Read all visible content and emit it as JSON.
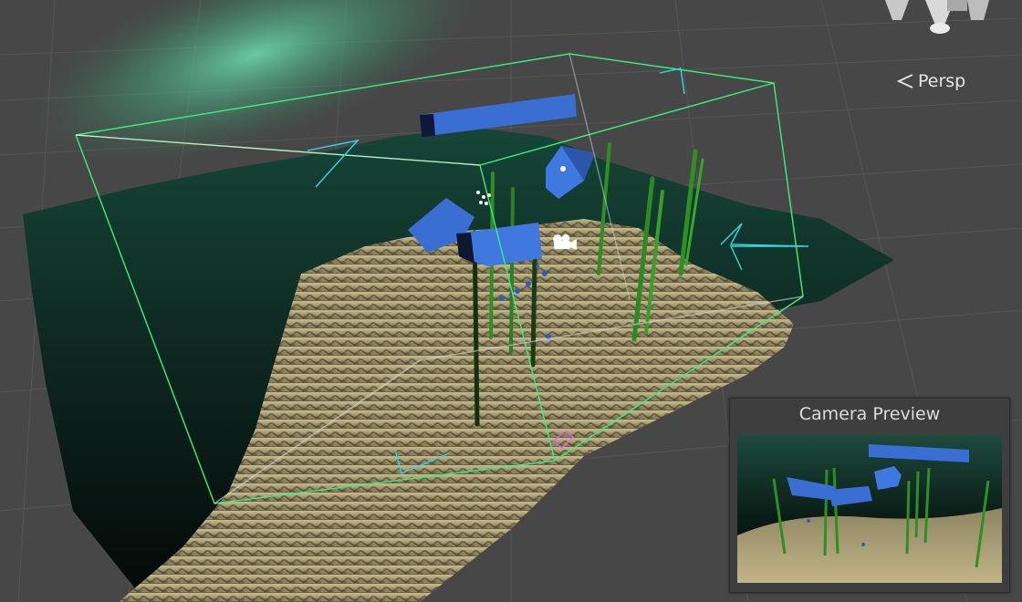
{
  "viewport": {
    "projection_label": "Persp",
    "projection_icon": "chevron-left-icon",
    "gizmo_icon": "axis-orientation-gizmo-icon"
  },
  "scene": {
    "sand_color": "#a89c72",
    "water_color": "#0f2a23",
    "light_beam_color": "#5fd1a2",
    "bounds_color": "#3bf07a",
    "rock_color": "#3a6ed2",
    "kelp_color": "#2f8f24",
    "grid_color": "#5a5a5a",
    "camera_icon": "camera-icon",
    "particle_icon": "particle-system-icon",
    "light_icon": "directional-light-icon"
  },
  "preview": {
    "title": "Camera Preview"
  }
}
